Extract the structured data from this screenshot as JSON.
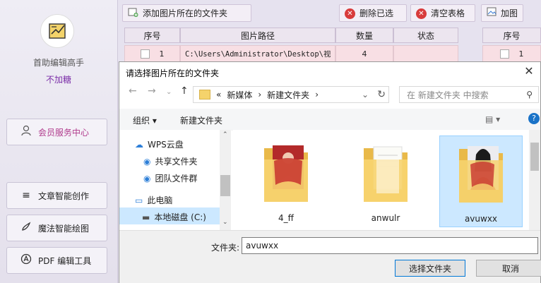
{
  "sidebar": {
    "app_name": "首助编辑高手",
    "subtitle": "不加糖",
    "member": "会员服务中心",
    "items": [
      {
        "label": "文章智能创作",
        "icon": "document-lines-icon"
      },
      {
        "label": "魔法智能绘图",
        "icon": "brush-icon"
      },
      {
        "label": "PDF 编辑工具",
        "icon": "pdf-icon"
      }
    ]
  },
  "toolbar": {
    "add_folder": "添加图片所在的文件夹",
    "delete_selected": "删除已选",
    "clear_table": "清空表格",
    "add_image": "加图"
  },
  "table": {
    "headers": [
      "序号",
      "图片路径",
      "数量",
      "状态"
    ],
    "rows": [
      {
        "index": "1",
        "path": "C:\\Users\\Administrator\\Desktop\\视",
        "count": "4",
        "status": ""
      }
    ]
  },
  "table2": {
    "header": "序号",
    "rows": [
      {
        "index": "1"
      }
    ]
  },
  "dialog": {
    "title": "请选择图片所在的文件夹",
    "close": "✕",
    "breadcrumb": [
      "«",
      "新媒体",
      "新建文件夹"
    ],
    "search_placeholder": "在 新建文件夹 中搜索",
    "organize": "组织 ▾",
    "new_folder": "新建文件夹",
    "nav_items": [
      {
        "label": "WPS云盘",
        "icon": "cloud-icon"
      },
      {
        "label": "共享文件夹",
        "icon": "shared-folder-icon"
      },
      {
        "label": "团队文件群",
        "icon": "team-icon"
      },
      {
        "label": "此电脑",
        "icon": "computer-icon"
      },
      {
        "label": "本地磁盘 (C:)",
        "icon": "drive-icon"
      }
    ],
    "files": [
      {
        "name": "4_ff"
      },
      {
        "name": "anwulr"
      },
      {
        "name": "avuwxx"
      }
    ],
    "folder_label": "文件夹:",
    "folder_value": "avuwxx",
    "select_button": "选择文件夹",
    "cancel_button": "取消"
  },
  "colors": {
    "accent": "#7b2ea8",
    "selection": "#cce8ff",
    "row_pink": "#f8dfe4"
  }
}
